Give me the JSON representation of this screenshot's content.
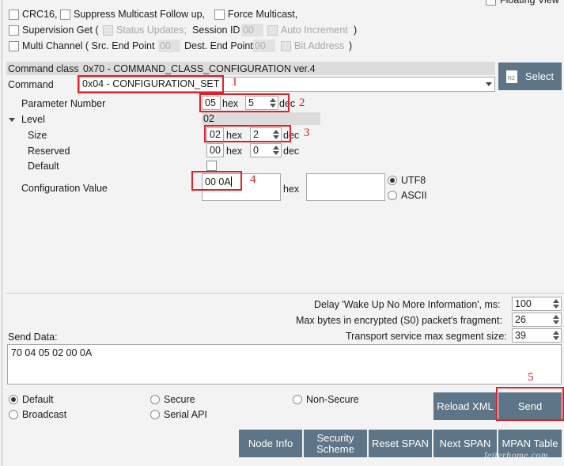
{
  "top": {
    "floating_view": "Floating View",
    "crc16": "CRC16,",
    "suppress_multicast": "Suppress Multicast Follow up,",
    "force_multicast": "Force Multicast,",
    "supervision_get": "Supervision Get (",
    "status_updates": "Status Updates;",
    "session_id": "Session ID",
    "session_id_value": "00",
    "auto_increment": "Auto Increment",
    "close_paren": ")",
    "multi_channel": "Multi Channel ( Src. End Point",
    "src_end_point_value": "00",
    "dest_end_point": "Dest. End Point",
    "dest_end_point_value": "00",
    "bit_address": "Bit Address",
    "close_paren2": ")"
  },
  "command": {
    "class_label": "Command class",
    "class_value": "0x70 - COMMAND_CLASS_CONFIGURATION ver.4",
    "command_label": "Command",
    "command_value": "0x04 - CONFIGURATION_SET",
    "select_button": "Select",
    "select_icon_text": "R2"
  },
  "params": {
    "parameter_number_label": "Parameter Number",
    "parameter_number_hex": "05",
    "parameter_number_dec": "5",
    "level_label": "Level",
    "level_value": "02",
    "size_label": "Size",
    "size_hex": "02",
    "size_dec": "2",
    "reserved_label": "Reserved",
    "reserved_hex": "00",
    "reserved_dec": "0",
    "default_label": "Default",
    "config_value_label": "Configuration Value",
    "config_value_hex": "00 0A",
    "hex_label": "hex",
    "dec_label": "dec",
    "utf8_label": "UTF8",
    "ascii_label": "ASCII"
  },
  "delays": {
    "wake_up_label": "Delay 'Wake Up No More Information', ms:",
    "wake_up_value": "100",
    "max_bytes_label": "Max bytes in encrypted (S0) packet's fragment:",
    "max_bytes_value": "26",
    "transport_label": "Transport service max segment size:",
    "transport_value": "39"
  },
  "send_data": {
    "label": "Send Data:",
    "value": "70 04 05 02 00 0A"
  },
  "security": {
    "default": "Default",
    "secure": "Secure",
    "non_secure": "Non-Secure",
    "broadcast": "Broadcast",
    "serial_api": "Serial API"
  },
  "buttons": {
    "reload_xml": "Reload XML",
    "send": "Send",
    "node_info": "Node Info",
    "security_scheme": "Security Scheme",
    "reset_span": "Reset SPAN",
    "next_span": "Next SPAN",
    "mpan_table": "MPAN Table"
  },
  "annotations": {
    "n1": "1",
    "n2": "2",
    "n3": "3",
    "n4": "4",
    "n5": "5"
  },
  "watermark": "feiterhome.com",
  "colors": {
    "button_bg": "#5d7586",
    "annotation_red": "#e0202a"
  }
}
